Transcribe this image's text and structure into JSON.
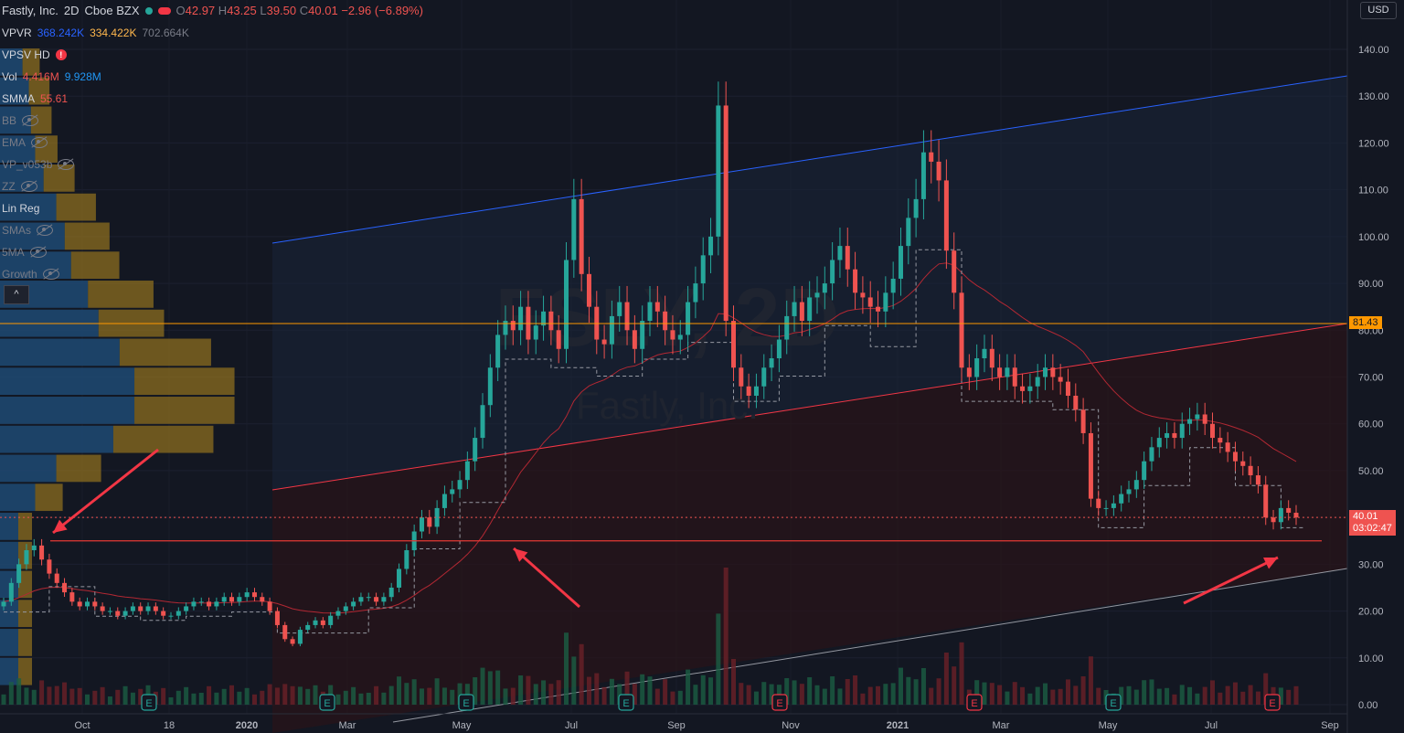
{
  "header": {
    "symbol": "Fastly, Inc.",
    "interval": "2D",
    "exchange": "Cboe BZX",
    "ohlc": {
      "o_label": "O",
      "o": "42.97",
      "h_label": "H",
      "h": "43.25",
      "l_label": "L",
      "l": "39.50",
      "c_label": "C",
      "c": "40.01",
      "change": "−2.96 (−6.89%)"
    }
  },
  "currency": "USD",
  "indicators": [
    {
      "name": "VPVR",
      "values": [
        "368.242K",
        "334.422K",
        "702.664K"
      ],
      "hidden": false
    },
    {
      "name": "VPSV HD",
      "warning": "!",
      "hidden": false
    },
    {
      "name": "Vol",
      "values": [
        "4.416M",
        "9.928M"
      ],
      "hidden": false
    },
    {
      "name": "SMMA",
      "values": [
        "55.61"
      ],
      "hidden": false
    },
    {
      "name": "BB",
      "hidden": true
    },
    {
      "name": "EMA",
      "hidden": true
    },
    {
      "name": "VP_v053b",
      "hidden": true
    },
    {
      "name": "ZZ",
      "hidden": true
    },
    {
      "name": "Lin Reg",
      "hidden": false
    },
    {
      "name": "SMAs",
      "hidden": true
    },
    {
      "name": "5MA",
      "hidden": true
    },
    {
      "name": "Growth",
      "hidden": true
    }
  ],
  "collapse_label": "^",
  "watermark": {
    "line1": "FSLY, 2D",
    "line2": "Fastly, Inc."
  },
  "price_labels": {
    "last": "40.01",
    "countdown": "03:02:47",
    "level": "81.43"
  },
  "colors": {
    "bg": "#131722",
    "up": "#26a69a",
    "down": "#ef5350",
    "orange": "#ff9800",
    "blue": "#2962ff",
    "red": "#f23645",
    "grid": "#1e222d"
  },
  "earnings_markers": [
    {
      "label": "E",
      "type": "pos"
    },
    {
      "label": "E",
      "type": "pos"
    },
    {
      "label": "E",
      "type": "pos"
    },
    {
      "label": "E",
      "type": "pos"
    },
    {
      "label": "E",
      "type": "neg"
    },
    {
      "label": "E",
      "type": "neg"
    },
    {
      "label": "E",
      "type": "pos"
    },
    {
      "label": "E",
      "type": "neg"
    },
    {
      "label": "E",
      "type": "pos"
    }
  ],
  "chart_data": {
    "type": "candlestick",
    "title": "Fastly, Inc. 2D Cboe BZX",
    "ylim": [
      0,
      145
    ],
    "y_ticks": [
      0,
      10,
      20,
      30,
      40,
      50,
      60,
      70,
      80,
      90,
      100,
      110,
      120,
      130,
      140
    ],
    "y_tick_labels": [
      "0.00",
      "10.00",
      "20.00",
      "30.00",
      "40.00",
      "50.00",
      "60.00",
      "70.00",
      "80.00",
      "90.00",
      "100.00",
      "110.00",
      "120.00",
      "130.00",
      "140.00"
    ],
    "x_tick_labels": [
      "Oct",
      "18",
      "2020",
      "Mar",
      "May",
      "Jul",
      "Sep",
      "Nov",
      "2021",
      "Mar",
      "May",
      "Jul",
      "Sep"
    ],
    "close_series": [
      22,
      26,
      30,
      33,
      34,
      31,
      28,
      26,
      24,
      22,
      21,
      22,
      21,
      20,
      20,
      19,
      20,
      21,
      20,
      21,
      20,
      19,
      19,
      20,
      21,
      22,
      22,
      21,
      22,
      23,
      22,
      23,
      24,
      23,
      22,
      20,
      17,
      14,
      13,
      16,
      17,
      18,
      17,
      19,
      20,
      21,
      22,
      23,
      23,
      22,
      23,
      25,
      29,
      33,
      37,
      40,
      38,
      42,
      45,
      46,
      48,
      52,
      57,
      64,
      72,
      79,
      82,
      80,
      85,
      78,
      81,
      84,
      80,
      76,
      95,
      108,
      92,
      85,
      78,
      77,
      83,
      86,
      80,
      76,
      82,
      86,
      84,
      80,
      78,
      79,
      86,
      90,
      96,
      100,
      128,
      82,
      72,
      68,
      66,
      68,
      72,
      74,
      78,
      83,
      86,
      82,
      87,
      88,
      90,
      95,
      98,
      93,
      88,
      87,
      85,
      84,
      88,
      91,
      98,
      104,
      108,
      118,
      116,
      112,
      97,
      88,
      72,
      70,
      74,
      76,
      72,
      70,
      72,
      68,
      67,
      68,
      70,
      72,
      70,
      69,
      66,
      63,
      58,
      44,
      42,
      42,
      43,
      45,
      46,
      48,
      52,
      55,
      57,
      58,
      57,
      60,
      61,
      62,
      60,
      57,
      56,
      54,
      52,
      51,
      49,
      47,
      40,
      39,
      42,
      41,
      40
    ],
    "volume_bars": "relative only (not labeled)",
    "price_levels": {
      "last": 40.01,
      "horizontal_level": 81.43,
      "support": 35
    },
    "annotations": [
      "up-right arrow at Oct 2019 low",
      "arrow to May 2020 support",
      "arrow to Aug 2021 low"
    ]
  }
}
